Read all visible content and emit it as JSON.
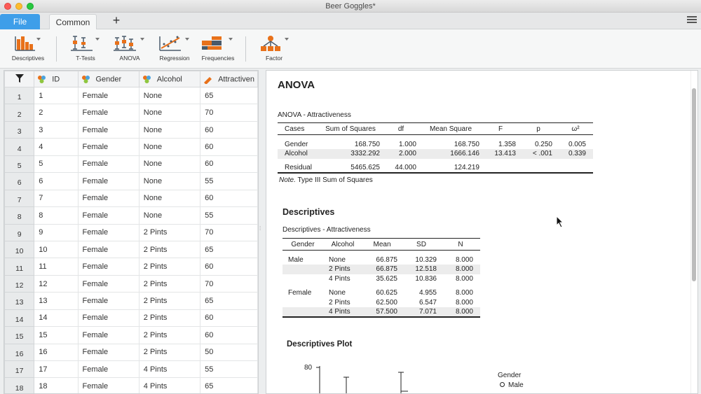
{
  "window": {
    "title": "Beer Goggles*"
  },
  "tabs": {
    "file": "File",
    "common": "Common",
    "add": "+"
  },
  "toolbar": {
    "items": [
      {
        "label": "Descriptives",
        "icon": "descriptives-icon"
      },
      {
        "label": "T-Tests",
        "icon": "t-tests-icon"
      },
      {
        "label": "ANOVA",
        "icon": "anova-icon"
      },
      {
        "label": "Regression",
        "icon": "regression-icon"
      },
      {
        "label": "Frequencies",
        "icon": "frequencies-icon"
      },
      {
        "label": "Factor",
        "icon": "factor-icon"
      }
    ]
  },
  "grid": {
    "columns": [
      "ID",
      "Gender",
      "Alcohol",
      "Attractiven"
    ],
    "rows": [
      [
        "1",
        "1",
        "Female",
        "None",
        "65"
      ],
      [
        "2",
        "2",
        "Female",
        "None",
        "70"
      ],
      [
        "3",
        "3",
        "Female",
        "None",
        "60"
      ],
      [
        "4",
        "4",
        "Female",
        "None",
        "60"
      ],
      [
        "5",
        "5",
        "Female",
        "None",
        "60"
      ],
      [
        "6",
        "6",
        "Female",
        "None",
        "55"
      ],
      [
        "7",
        "7",
        "Female",
        "None",
        "60"
      ],
      [
        "8",
        "8",
        "Female",
        "None",
        "55"
      ],
      [
        "9",
        "9",
        "Female",
        "2 Pints",
        "70"
      ],
      [
        "10",
        "10",
        "Female",
        "2 Pints",
        "65"
      ],
      [
        "11",
        "11",
        "Female",
        "2 Pints",
        "60"
      ],
      [
        "12",
        "12",
        "Female",
        "2 Pints",
        "70"
      ],
      [
        "13",
        "13",
        "Female",
        "2 Pints",
        "65"
      ],
      [
        "14",
        "14",
        "Female",
        "2 Pints",
        "60"
      ],
      [
        "15",
        "15",
        "Female",
        "2 Pints",
        "60"
      ],
      [
        "16",
        "16",
        "Female",
        "2 Pints",
        "50"
      ],
      [
        "17",
        "17",
        "Female",
        "4 Pints",
        "55"
      ],
      [
        "18",
        "18",
        "Female",
        "4 Pints",
        "65"
      ]
    ]
  },
  "results": {
    "anova_title": "ANOVA",
    "anova_table_title": "ANOVA - Attractiveness",
    "anova_headers": [
      "Cases",
      "Sum of Squares",
      "df",
      "Mean Square",
      "F",
      "p",
      "ω²"
    ],
    "anova_rows": [
      [
        "Gender",
        "168.750",
        "1.000",
        "168.750",
        "1.358",
        "0.250",
        "0.005"
      ],
      [
        "Alcohol",
        "3332.292",
        "2.000",
        "1666.146",
        "13.413",
        "< .001",
        "0.339"
      ],
      [
        "Residual",
        "5465.625",
        "44.000",
        "124.219",
        "",
        "",
        ""
      ]
    ],
    "note_label": "Note.",
    "note_text": " Type III Sum of Squares",
    "desc_title": "Descriptives",
    "desc_table_title": "Descriptives - Attractiveness",
    "desc_headers": [
      "Gender",
      "Alcohol",
      "Mean",
      "SD",
      "N"
    ],
    "desc_rows": [
      [
        "Male",
        "None",
        "66.875",
        "10.329",
        "8.000"
      ],
      [
        "",
        "2 Pints",
        "66.875",
        "12.518",
        "8.000"
      ],
      [
        "",
        "4 Pints",
        "35.625",
        "10.836",
        "8.000"
      ],
      [
        "Female",
        "None",
        "60.625",
        "4.955",
        "8.000"
      ],
      [
        "",
        "2 Pints",
        "62.500",
        "6.547",
        "8.000"
      ],
      [
        "",
        "4 Pints",
        "57.500",
        "7.071",
        "8.000"
      ]
    ],
    "plot_title": "Descriptives Plot",
    "plot_axis_tick": "80",
    "legend_title": "Gender",
    "legend_item": "Male"
  },
  "colors": {
    "accent": "#3e9ee9",
    "toolbar_icon": "#e8711a"
  }
}
